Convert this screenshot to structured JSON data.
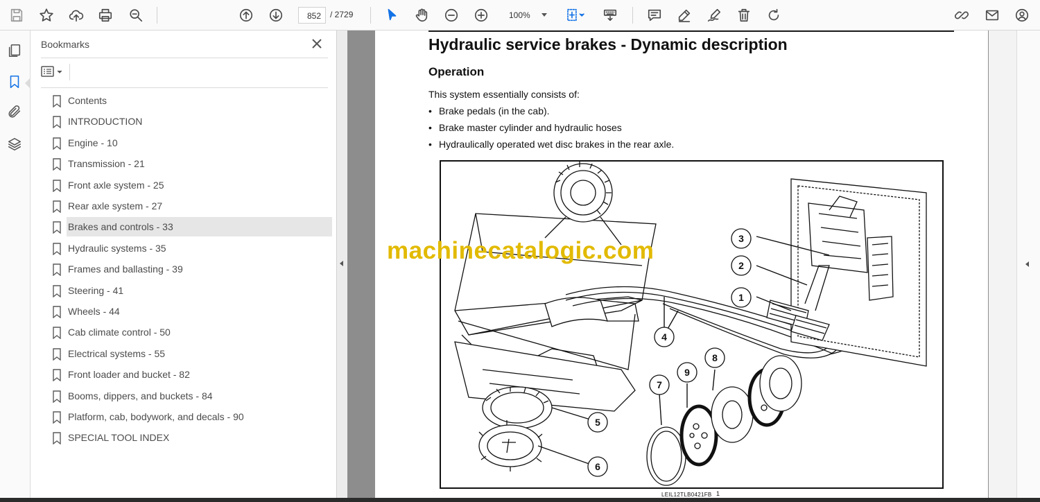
{
  "toolbar": {
    "page_current": "852",
    "page_total": "/ 2729",
    "zoom": "100%",
    "left_icons": [
      "save-icon",
      "star-icon",
      "upload-icon",
      "print-icon",
      "zoom-search-icon"
    ],
    "nav_icons": [
      "page-up-icon",
      "page-down-icon"
    ],
    "mid_icons": [
      "select-cursor-icon",
      "hand-tool-icon",
      "zoom-out-icon",
      "zoom-in-icon"
    ],
    "right_icons": [
      "fit-page-icon",
      "keyboard-icon",
      "comment-icon",
      "highlight-pen-icon",
      "sign-icon",
      "delete-icon",
      "rotate-icon",
      "link-icon",
      "mail-icon",
      "account-icon"
    ]
  },
  "sidebar": {
    "title": "Bookmarks",
    "items": [
      {
        "label": "Contents"
      },
      {
        "label": "INTRODUCTION"
      },
      {
        "label": "Engine - 10"
      },
      {
        "label": "Transmission - 21"
      },
      {
        "label": "Front axle system - 25"
      },
      {
        "label": "Rear axle system - 27"
      },
      {
        "label": "Brakes and controls - 33",
        "selected": true
      },
      {
        "label": "Hydraulic systems - 35"
      },
      {
        "label": "Frames and ballasting - 39"
      },
      {
        "label": "Steering - 41"
      },
      {
        "label": "Wheels - 44"
      },
      {
        "label": "Cab climate control - 50"
      },
      {
        "label": "Electrical systems - 55"
      },
      {
        "label": "Front loader and bucket - 82"
      },
      {
        "label": "Booms, dippers, and buckets - 84"
      },
      {
        "label": "Platform, cab, bodywork, and decals - 90"
      },
      {
        "label": "SPECIAL TOOL INDEX"
      }
    ]
  },
  "document": {
    "heading": "Hydraulic service brakes - Dynamic description",
    "subheading": "Operation",
    "intro": "This system essentially consists of:",
    "bullets": [
      "Brake pedals (in the cab).",
      "Brake master cylinder and hydraulic hoses",
      "Hydraulically operated wet disc brakes in the rear axle."
    ],
    "figure_callouts": [
      "1",
      "2",
      "3",
      "4",
      "5",
      "6",
      "7",
      "8",
      "9"
    ],
    "figure_code": "LEIL12TLB0421FB",
    "figure_number": "1",
    "watermark": "machinecatalogic.com"
  },
  "colors": {
    "accent": "#1473e6",
    "watermark": "#e2ba00",
    "selected_bookmark": "#e6e6e6",
    "doc_background": "#8d8d8d"
  }
}
